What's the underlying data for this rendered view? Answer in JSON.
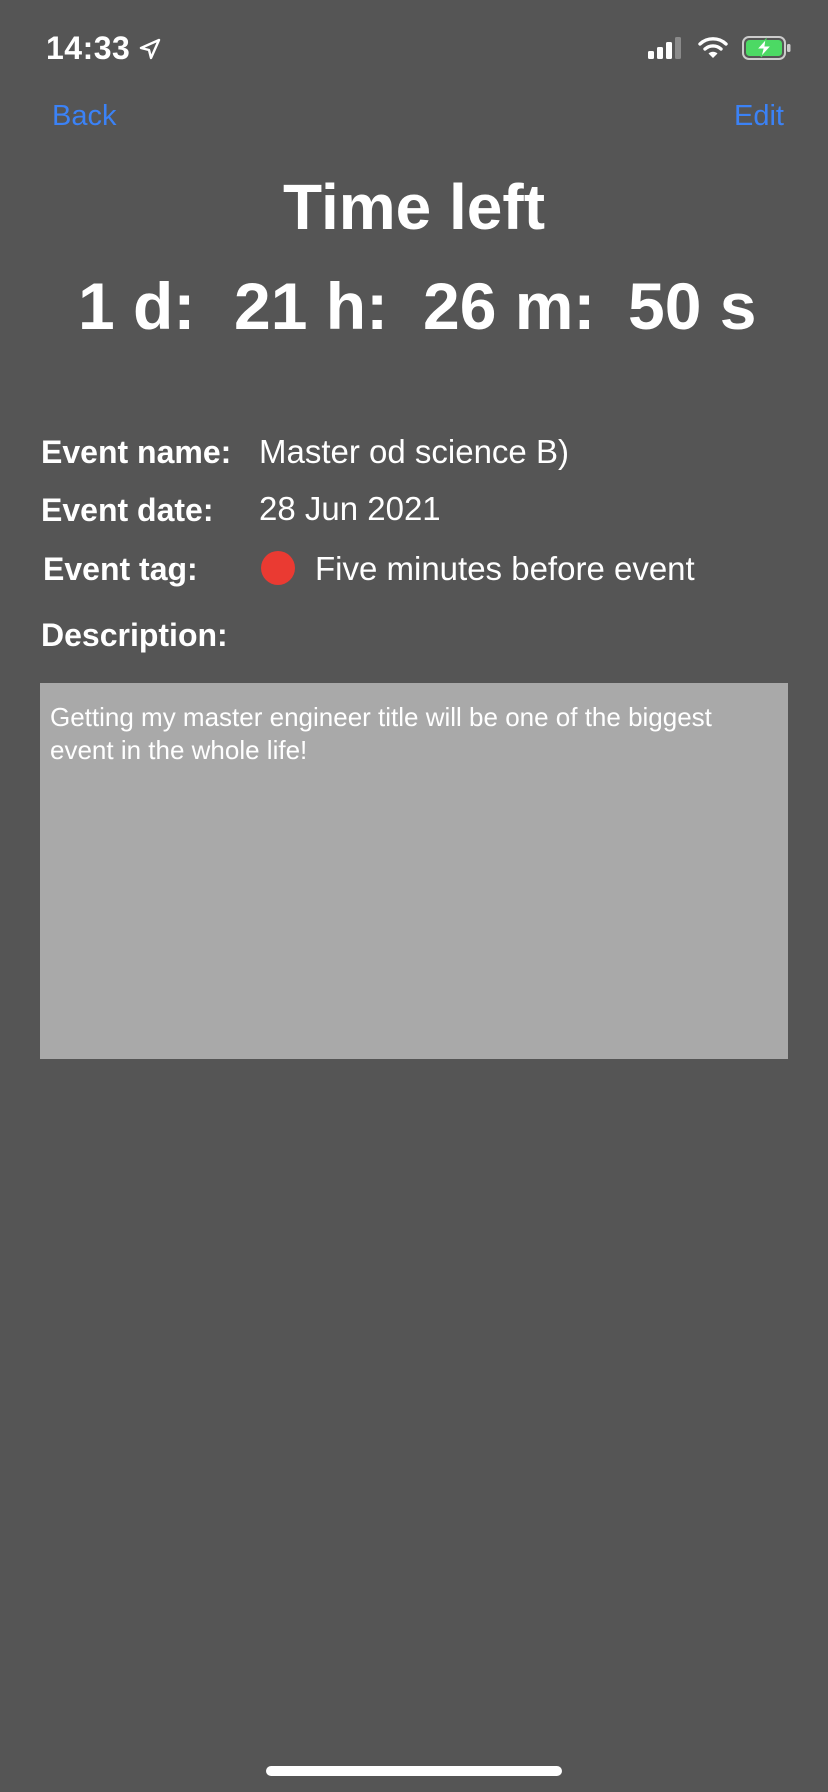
{
  "status_bar": {
    "time": "14:33",
    "icons": [
      "location-arrow-icon",
      "signal-icon",
      "wifi-icon",
      "battery-charging-icon"
    ]
  },
  "nav": {
    "back_label": "Back",
    "edit_label": "Edit"
  },
  "header": {
    "title": "Time left",
    "countdown": {
      "days": "1 d:",
      "hours": "21 h:",
      "minutes": "26 m:",
      "seconds": "50 s"
    }
  },
  "details": {
    "name_label": "Event name:",
    "name_value": "Master od science B)",
    "date_label": "Event date:",
    "date_value": "28 Jun 2021",
    "tag_label": "Event tag:",
    "tag_value": "Five minutes before event",
    "tag_color": "#ea3a32",
    "description_label": "Description:",
    "description_value": "Getting my master engineer title will be one of the biggest event in the whole life!"
  },
  "colors": {
    "background": "#555555",
    "accent": "#3b82f6",
    "description_box": "#a9a9a9"
  }
}
